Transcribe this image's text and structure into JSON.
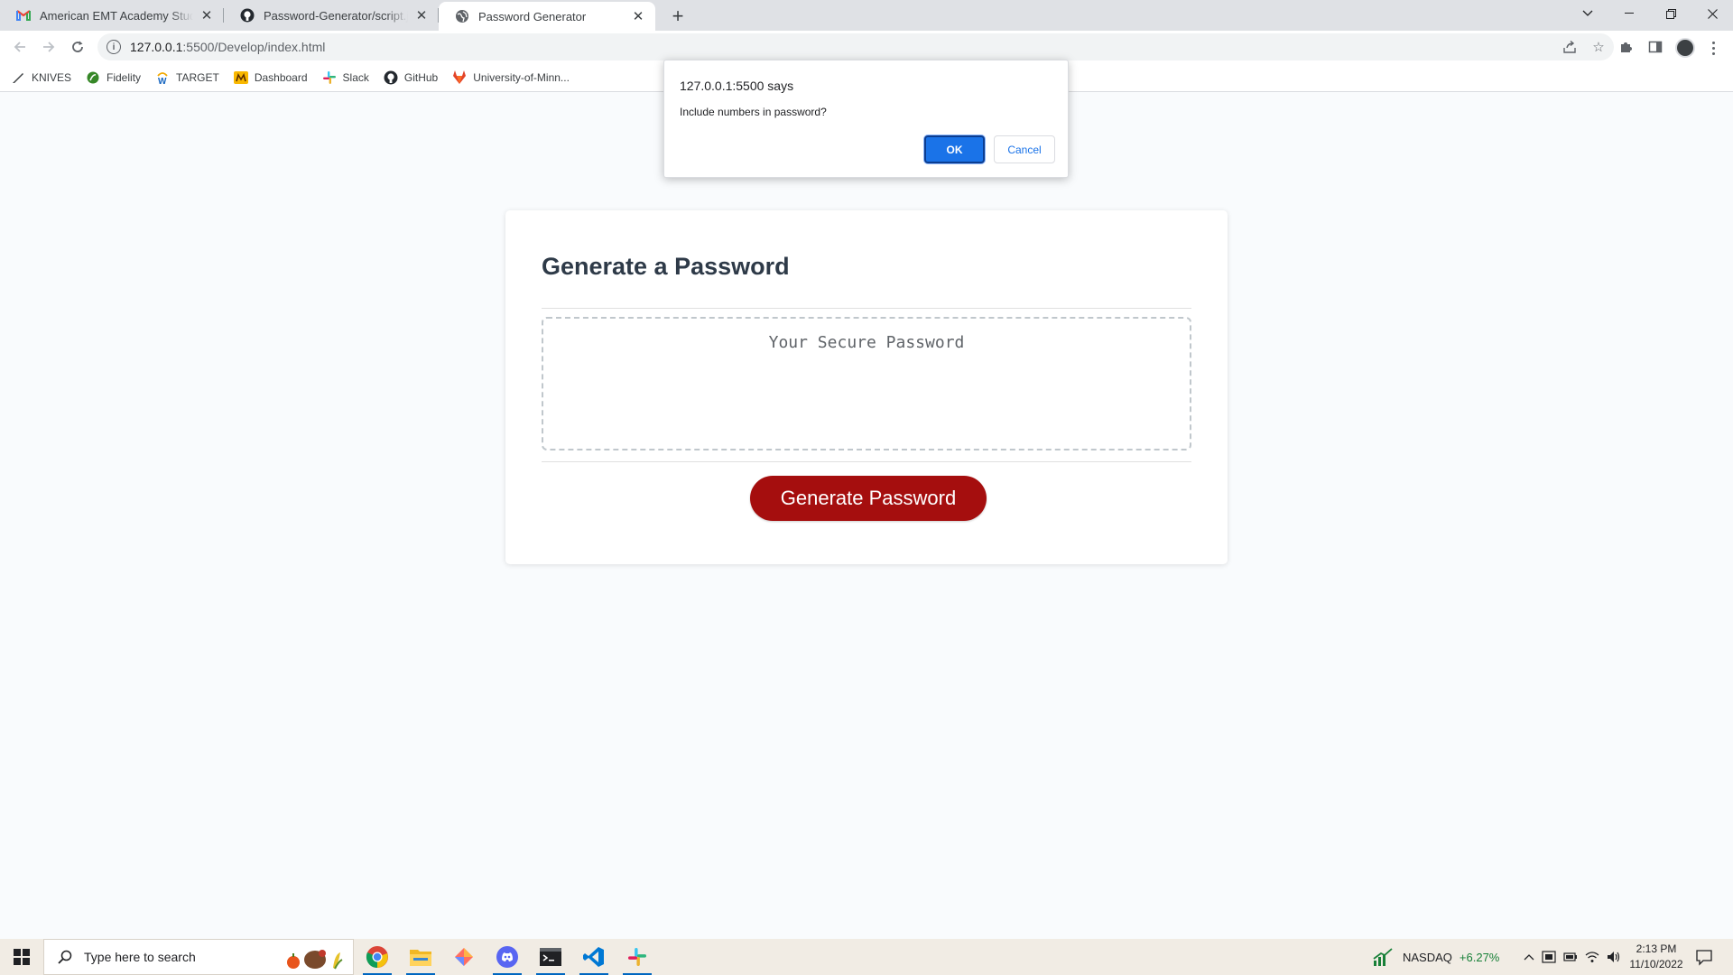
{
  "browser": {
    "tabs": [
      {
        "title": "American EMT Academy Student",
        "icon": "gmail-icon",
        "active": false
      },
      {
        "title": "Password-Generator/script.js at m",
        "icon": "github-icon",
        "active": false
      },
      {
        "title": "Password Generator",
        "icon": "globe-icon",
        "active": true
      }
    ],
    "url_host": "127.0.0.1",
    "url_path": ":5500/Develop/index.html",
    "bookmarks": [
      {
        "label": "KNIVES",
        "icon": "knife-icon"
      },
      {
        "label": "Fidelity",
        "icon": "fidelity-icon"
      },
      {
        "label": "TARGET",
        "icon": "target-w-icon"
      },
      {
        "label": "Dashboard",
        "icon": "dashboard-icon"
      },
      {
        "label": "Slack",
        "icon": "slack-icon"
      },
      {
        "label": "GitHub",
        "icon": "github-icon"
      },
      {
        "label": "University-of-Minn...",
        "icon": "gitlab-icon"
      }
    ]
  },
  "dialog": {
    "title": "127.0.0.1:5500 says",
    "message": "Include numbers in password?",
    "ok_label": "OK",
    "cancel_label": "Cancel"
  },
  "app": {
    "heading": "Generate a Password",
    "password_placeholder": "Your Secure Password",
    "generate_label": "Generate Password",
    "button_color": "#a50e0e"
  },
  "taskbar": {
    "search_placeholder": "Type here to search",
    "stock_name": "NASDAQ",
    "stock_change": "+6.27%",
    "time": "2:13 PM",
    "date": "11/10/2022"
  }
}
